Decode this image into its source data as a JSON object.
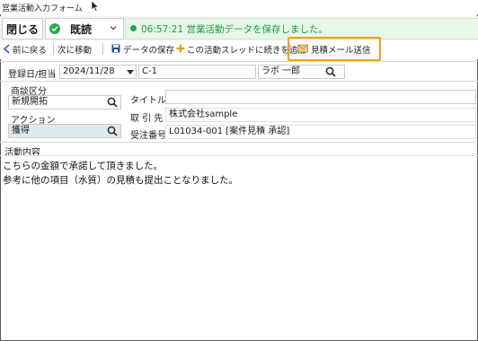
{
  "window": {
    "title": "営業活動入力フォーム"
  },
  "header": {
    "close_label": "閉じる",
    "status_label": "既読",
    "notification": "06:57:21 営業活動データを保存しました。"
  },
  "toolbar": {
    "back_label": "前に戻る",
    "next_label": "次に移動",
    "save_label": "データの保存",
    "continue_label": "この活動スレッドに続きを追加",
    "quote_mail_label": "見積メール送信"
  },
  "form": {
    "date_label": "登録日/担当",
    "date_value": "2024/11/28",
    "staff_code": "C-1",
    "staff_name": "ラボ 一郎",
    "category_label": "商談区分",
    "category_value": "新規開拓",
    "title_label": "タイトル",
    "title_value": "",
    "action_label": "アクション",
    "action_value": "獲得",
    "client_label": "取 引 先",
    "client_value": "株式会社sample",
    "order_label": "受注番号",
    "order_value": "L01034-001 [案件見積 承認]",
    "activity_label": "活動内容",
    "activity_lines": [
      "こちらの金額で承諾して頂きました。",
      "参考に他の項目（水質）の見積も提出ことなりました。"
    ]
  },
  "colors": {
    "notify_bg": "#e8f6e8",
    "notify_text": "#1f9a46",
    "highlight": "#f2a20f",
    "action_bg": "#dcebf0"
  }
}
